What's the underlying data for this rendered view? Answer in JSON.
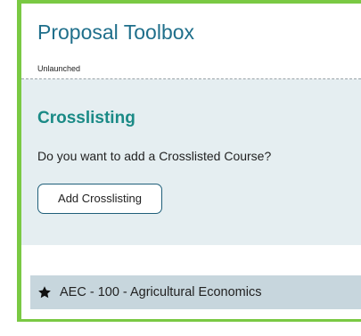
{
  "toolbox": {
    "title": "Proposal Toolbox",
    "status": "Unlaunched"
  },
  "crosslisting": {
    "heading": "Crosslisting",
    "question": "Do you want to add a Crosslisted Course?",
    "button_label": "Add Crosslisting"
  },
  "course_list": {
    "items": [
      {
        "icon": "star-icon",
        "label": "AEC - 100 - Agricultural Economics"
      }
    ]
  },
  "colors": {
    "accent_green": "#7ac943",
    "title_blue": "#1f6f8b",
    "section_teal": "#1a8a86",
    "section_background": "#e5eef1",
    "row_background": "#c7d6dd"
  }
}
